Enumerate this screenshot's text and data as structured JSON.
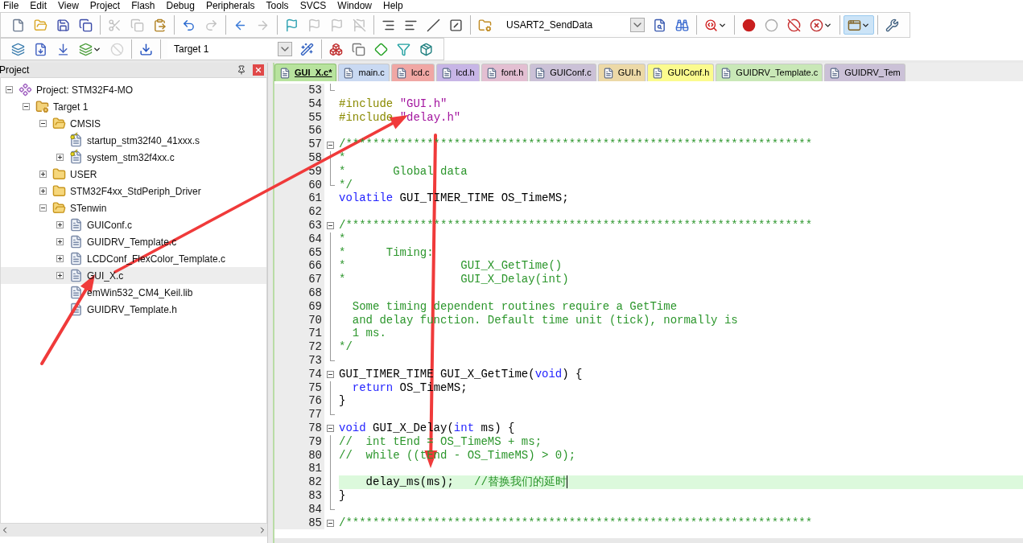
{
  "menu": [
    "File",
    "Edit",
    "View",
    "Project",
    "Flash",
    "Debug",
    "Peripherals",
    "Tools",
    "SVCS",
    "Window",
    "Help"
  ],
  "toolbar_1": {
    "groups": [
      [
        {
          "kind": "new",
          "disabled": false,
          "pressed": false
        },
        {
          "kind": "open",
          "disabled": false,
          "pressed": false
        },
        {
          "kind": "save",
          "disabled": false,
          "pressed": false
        },
        {
          "kind": "saveall",
          "disabled": false,
          "pressed": false
        }
      ],
      [
        {
          "kind": "cut",
          "disabled": true,
          "pressed": false
        },
        {
          "kind": "copy",
          "disabled": true,
          "pressed": false
        },
        {
          "kind": "paste",
          "disabled": false,
          "pressed": false
        }
      ],
      [
        {
          "kind": "undo",
          "disabled": false,
          "pressed": false
        },
        {
          "kind": "redo",
          "disabled": true,
          "pressed": false
        }
      ],
      [
        {
          "kind": "back",
          "disabled": false,
          "pressed": false
        },
        {
          "kind": "forward",
          "disabled": true,
          "pressed": false
        }
      ],
      [
        {
          "kind": "bookmark",
          "disabled": false,
          "pressed": false
        },
        {
          "kind": "bookmarkprev",
          "disabled": true,
          "pressed": false
        },
        {
          "kind": "bookmarknext",
          "disabled": true,
          "pressed": false
        },
        {
          "kind": "bookmarkclear",
          "disabled": true,
          "pressed": false
        }
      ],
      [
        {
          "kind": "indent",
          "disabled": false,
          "pressed": false
        },
        {
          "kind": "outdent",
          "disabled": false,
          "pressed": false
        },
        {
          "kind": "comment",
          "disabled": false,
          "pressed": false
        },
        {
          "kind": "uncomment",
          "disabled": false,
          "pressed": false
        }
      ],
      [
        {
          "kind": "configure",
          "disabled": false,
          "pressed": false
        },
        {
          "kind": "combo",
          "value": "USART2_SendData",
          "disabled": false,
          "pressed": false
        },
        {
          "kind": "findfiles",
          "disabled": false,
          "pressed": false
        },
        {
          "kind": "find",
          "disabled": false,
          "pressed": false
        }
      ],
      [
        {
          "kind": "debug",
          "disabled": false,
          "pressed": false
        }
      ],
      [
        {
          "kind": "breakpoint",
          "disabled": false,
          "pressed": false
        },
        {
          "kind": "bpenable",
          "disabled": false,
          "pressed": false
        },
        {
          "kind": "bpdisable",
          "disabled": false,
          "pressed": false
        },
        {
          "kind": "bpkill",
          "disabled": false,
          "pressed": false
        }
      ],
      [
        {
          "kind": "windows",
          "disabled": false,
          "pressed": true
        }
      ],
      [
        {
          "kind": "wrench",
          "disabled": false,
          "pressed": false
        }
      ]
    ]
  },
  "toolbar_2": {
    "groups": [
      [
        {
          "kind": "translate",
          "disabled": false,
          "pressed": false
        },
        {
          "kind": "build",
          "disabled": false,
          "pressed": false
        },
        {
          "kind": "rebuild",
          "disabled": false,
          "pressed": false
        },
        {
          "kind": "batch",
          "disabled": false,
          "pressed": false
        },
        {
          "kind": "stop",
          "disabled": true,
          "pressed": false
        }
      ],
      [
        {
          "kind": "download",
          "disabled": false,
          "pressed": false
        }
      ],
      [
        {
          "kind": "target",
          "value": "Target 1",
          "disabled": false,
          "pressed": false
        },
        {
          "kind": "wand",
          "disabled": false,
          "pressed": false
        }
      ],
      [
        {
          "kind": "options",
          "disabled": false,
          "pressed": false
        },
        {
          "kind": "manage",
          "disabled": false,
          "pressed": false
        },
        {
          "kind": "packs",
          "disabled": false,
          "pressed": false
        },
        {
          "kind": "filter",
          "disabled": false,
          "pressed": false
        },
        {
          "kind": "pack",
          "disabled": false,
          "pressed": false
        }
      ]
    ]
  },
  "project": {
    "title": "Project",
    "tree": [
      {
        "label": "Project: STM32F4-MO",
        "kind": "project",
        "selected": false,
        "expanded": true,
        "children": [
          {
            "label": "Target 1",
            "kind": "target",
            "selected": false,
            "expanded": true,
            "children": [
              {
                "label": "CMSIS",
                "kind": "folder",
                "selected": false,
                "expanded": true,
                "children": [
                  {
                    "label": "startup_stm32f40_41xxx.s",
                    "kind": "keyfile",
                    "selected": false
                  },
                  {
                    "label": "system_stm32f4xx.c",
                    "kind": "keyfile",
                    "selected": false,
                    "expanded": false
                  }
                ]
              },
              {
                "label": "USER",
                "kind": "folder",
                "selected": false,
                "expanded": false
              },
              {
                "label": "STM32F4xx_StdPeriph_Driver",
                "kind": "folder",
                "selected": false,
                "expanded": false
              },
              {
                "label": "STenwin",
                "kind": "folder",
                "selected": false,
                "expanded": true,
                "children": [
                  {
                    "label": "GUIConf.c",
                    "kind": "file",
                    "selected": false,
                    "expanded": false
                  },
                  {
                    "label": "GUIDRV_Template.c",
                    "kind": "file",
                    "selected": false,
                    "expanded": false
                  },
                  {
                    "label": "LCDConf_FlexColor_Template.c",
                    "kind": "file",
                    "selected": false,
                    "expanded": false
                  },
                  {
                    "label": "GUI_X.c",
                    "kind": "file",
                    "selected": true,
                    "expanded": false
                  },
                  {
                    "label": "emWin532_CM4_Keil.lib",
                    "kind": "file",
                    "selected": false
                  },
                  {
                    "label": "GUIDRV_Template.h",
                    "kind": "file",
                    "selected": false
                  }
                ]
              }
            ]
          }
        ]
      }
    ]
  },
  "tabs": [
    {
      "label": "GUI_X.c*",
      "selected": true,
      "color": "#b8e39e"
    },
    {
      "label": "main.c",
      "selected": false,
      "color": "#c9d9f2"
    },
    {
      "label": "lcd.c",
      "selected": false,
      "color": "#f0a7a4"
    },
    {
      "label": "lcd.h",
      "selected": false,
      "color": "#c7b5e6"
    },
    {
      "label": "font.h",
      "selected": false,
      "color": "#e3bfd2"
    },
    {
      "label": "GUIConf.c",
      "selected": false,
      "color": "#cbc1d7"
    },
    {
      "label": "GUI.h",
      "selected": false,
      "color": "#ecd9a7"
    },
    {
      "label": "GUIConf.h",
      "selected": false,
      "color": "#fbfb8e"
    },
    {
      "label": "GUIDRV_Template.c",
      "selected": false,
      "color": "#c9e8b7"
    },
    {
      "label": "GUIDRV_Tem",
      "selected": false,
      "color": "#cbc1d7"
    }
  ],
  "editor": {
    "lines": [
      {
        "number": "53",
        "kind": "foldend",
        "current": false
      },
      {
        "number": "54",
        "kind": "plain",
        "current": false,
        "tokens": [
          {
            "kind": "pre",
            "text": "#include "
          },
          {
            "kind": "str",
            "text": "\"GUI.h\""
          }
        ]
      },
      {
        "number": "55",
        "kind": "plain",
        "current": false,
        "tokens": [
          {
            "kind": "pre",
            "text": "#include "
          },
          {
            "kind": "str",
            "text": "\"delay.h\""
          }
        ]
      },
      {
        "number": "56",
        "kind": "plain",
        "current": false
      },
      {
        "number": "57",
        "kind": "foldstart",
        "current": false,
        "tokens": [
          {
            "kind": "com",
            "text": "/*********************************************************************"
          }
        ]
      },
      {
        "number": "58",
        "kind": "foldbody",
        "current": false,
        "tokens": [
          {
            "kind": "com",
            "text": "*"
          }
        ]
      },
      {
        "number": "59",
        "kind": "foldbody",
        "current": false,
        "tokens": [
          {
            "kind": "com",
            "text": "*       Global data"
          }
        ]
      },
      {
        "number": "60",
        "kind": "foldend",
        "current": false,
        "tokens": [
          {
            "kind": "com",
            "text": "*/"
          }
        ]
      },
      {
        "number": "61",
        "kind": "plain",
        "current": false,
        "tokens": [
          {
            "kind": "kw",
            "text": "volatile"
          },
          {
            "kind": "plain",
            "text": " GUI_TIMER_TIME OS_TimeMS;"
          }
        ]
      },
      {
        "number": "62",
        "kind": "plain",
        "current": false
      },
      {
        "number": "63",
        "kind": "foldstart",
        "current": false,
        "tokens": [
          {
            "kind": "com",
            "text": "/*********************************************************************"
          }
        ]
      },
      {
        "number": "64",
        "kind": "foldbody",
        "current": false,
        "tokens": [
          {
            "kind": "com",
            "text": "*"
          }
        ]
      },
      {
        "number": "65",
        "kind": "foldbody",
        "current": false,
        "tokens": [
          {
            "kind": "com",
            "text": "*      Timing:"
          }
        ]
      },
      {
        "number": "66",
        "kind": "foldbody",
        "current": false,
        "tokens": [
          {
            "kind": "com",
            "text": "*                 GUI_X_GetTime()"
          }
        ]
      },
      {
        "number": "67",
        "kind": "foldbody",
        "current": false,
        "tokens": [
          {
            "kind": "com",
            "text": "*                 GUI_X_Delay(int)"
          }
        ]
      },
      {
        "number": "68",
        "kind": "foldbody",
        "current": false
      },
      {
        "number": "69",
        "kind": "foldbody",
        "current": false,
        "tokens": [
          {
            "kind": "com",
            "text": "  Some timing dependent routines require a GetTime"
          }
        ]
      },
      {
        "number": "70",
        "kind": "foldbody",
        "current": false,
        "tokens": [
          {
            "kind": "com",
            "text": "  and delay function. Default time unit (tick), normally is"
          }
        ]
      },
      {
        "number": "71",
        "kind": "foldbody",
        "current": false,
        "tokens": [
          {
            "kind": "com",
            "text": "  1 ms."
          }
        ]
      },
      {
        "number": "72",
        "kind": "foldbody",
        "current": false,
        "tokens": [
          {
            "kind": "com",
            "text": "*/"
          }
        ]
      },
      {
        "number": "73",
        "kind": "foldend",
        "current": false
      },
      {
        "number": "74",
        "kind": "foldstart",
        "current": false,
        "tokens": [
          {
            "kind": "plain",
            "text": "GUI_TIMER_TIME GUI_X_GetTime("
          },
          {
            "kind": "kw",
            "text": "void"
          },
          {
            "kind": "plain",
            "text": ") {"
          }
        ]
      },
      {
        "number": "75",
        "kind": "foldbody",
        "current": false,
        "tokens": [
          {
            "kind": "kw",
            "text": "  return"
          },
          {
            "kind": "plain",
            "text": " OS_TimeMS;"
          }
        ]
      },
      {
        "number": "76",
        "kind": "foldbody",
        "current": false,
        "tokens": [
          {
            "kind": "plain",
            "text": "}"
          }
        ]
      },
      {
        "number": "77",
        "kind": "foldend",
        "current": false
      },
      {
        "number": "78",
        "kind": "foldstart",
        "current": false,
        "tokens": [
          {
            "kind": "kw",
            "text": "void"
          },
          {
            "kind": "plain",
            "text": " GUI_X_Delay("
          },
          {
            "kind": "kw",
            "text": "int"
          },
          {
            "kind": "plain",
            "text": " ms) {"
          }
        ]
      },
      {
        "number": "79",
        "kind": "foldbody",
        "current": false,
        "tokens": [
          {
            "kind": "com",
            "text": "//  int tEnd = OS_TimeMS + ms;"
          }
        ]
      },
      {
        "number": "80",
        "kind": "foldbody",
        "current": false,
        "tokens": [
          {
            "kind": "com",
            "text": "//  while ((tEnd - OS_TimeMS) > 0);"
          }
        ]
      },
      {
        "number": "81",
        "kind": "foldbody",
        "current": false
      },
      {
        "number": "82",
        "kind": "foldbody",
        "current": true,
        "tokens": [
          {
            "kind": "plain",
            "text": "    delay_ms(ms);   "
          },
          {
            "kind": "com",
            "text": "//替换我们的延时"
          }
        ]
      },
      {
        "number": "83",
        "kind": "foldbody",
        "current": false,
        "tokens": [
          {
            "kind": "plain",
            "text": "}"
          }
        ]
      },
      {
        "number": "84",
        "kind": "foldend",
        "current": false
      },
      {
        "number": "85",
        "kind": "foldstart",
        "current": false,
        "tokens": [
          {
            "kind": "com",
            "text": "/*********************************************************************"
          }
        ]
      }
    ]
  }
}
